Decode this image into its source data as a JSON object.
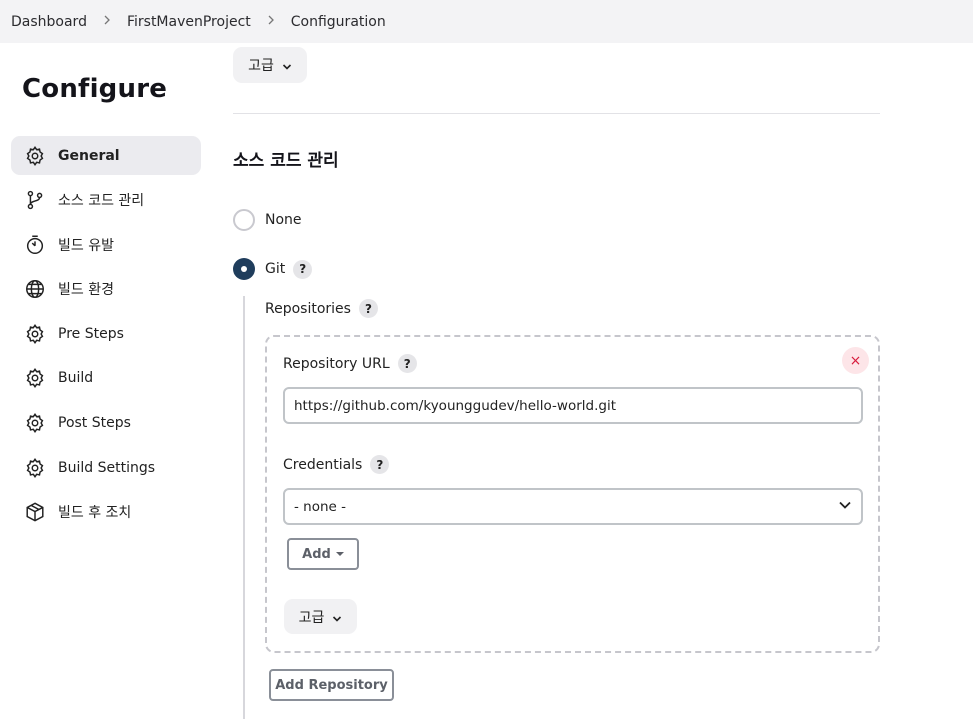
{
  "breadcrumb": {
    "items": [
      "Dashboard",
      "FirstMavenProject",
      "Configuration"
    ],
    "separator": ">"
  },
  "page": {
    "title": "Configure"
  },
  "sidebar": {
    "items": [
      {
        "label": "General",
        "icon": "gear-icon",
        "active": true
      },
      {
        "label": "소스 코드 관리",
        "icon": "git-branch-icon",
        "active": false
      },
      {
        "label": "빌드 유발",
        "icon": "timer-icon",
        "active": false
      },
      {
        "label": "빌드 환경",
        "icon": "globe-icon",
        "active": false
      },
      {
        "label": "Pre Steps",
        "icon": "gear-icon",
        "active": false
      },
      {
        "label": "Build",
        "icon": "gear-icon",
        "active": false
      },
      {
        "label": "Post Steps",
        "icon": "gear-icon",
        "active": false
      },
      {
        "label": "Build Settings",
        "icon": "gear-icon",
        "active": false
      },
      {
        "label": "빌드 후 조치",
        "icon": "package-icon",
        "active": false
      }
    ]
  },
  "main": {
    "advanced_top_label": "고급",
    "scm_section_title": "소스 코드 관리",
    "scm_options": [
      {
        "label": "None",
        "selected": false
      },
      {
        "label": "Git",
        "selected": true,
        "help": "?"
      }
    ],
    "git": {
      "repositories_label": "Repositories",
      "help": "?",
      "repository": {
        "url_label": "Repository URL",
        "url_value": "https://github.com/kyounggudev/hello-world.git",
        "credentials_label": "Credentials",
        "credentials_selected": "- none -",
        "add_label": "Add",
        "advanced_label": "고급",
        "remove_icon": "×"
      },
      "add_repository_label": "Add Repository"
    }
  },
  "colors": {
    "breadcrumb_bg": "#f3f3f5",
    "active_nav_bg": "#ebebef",
    "radio_selected": "#1f3d5c",
    "remove_red": "#d81b3c",
    "remove_bg": "#fde5e8"
  }
}
